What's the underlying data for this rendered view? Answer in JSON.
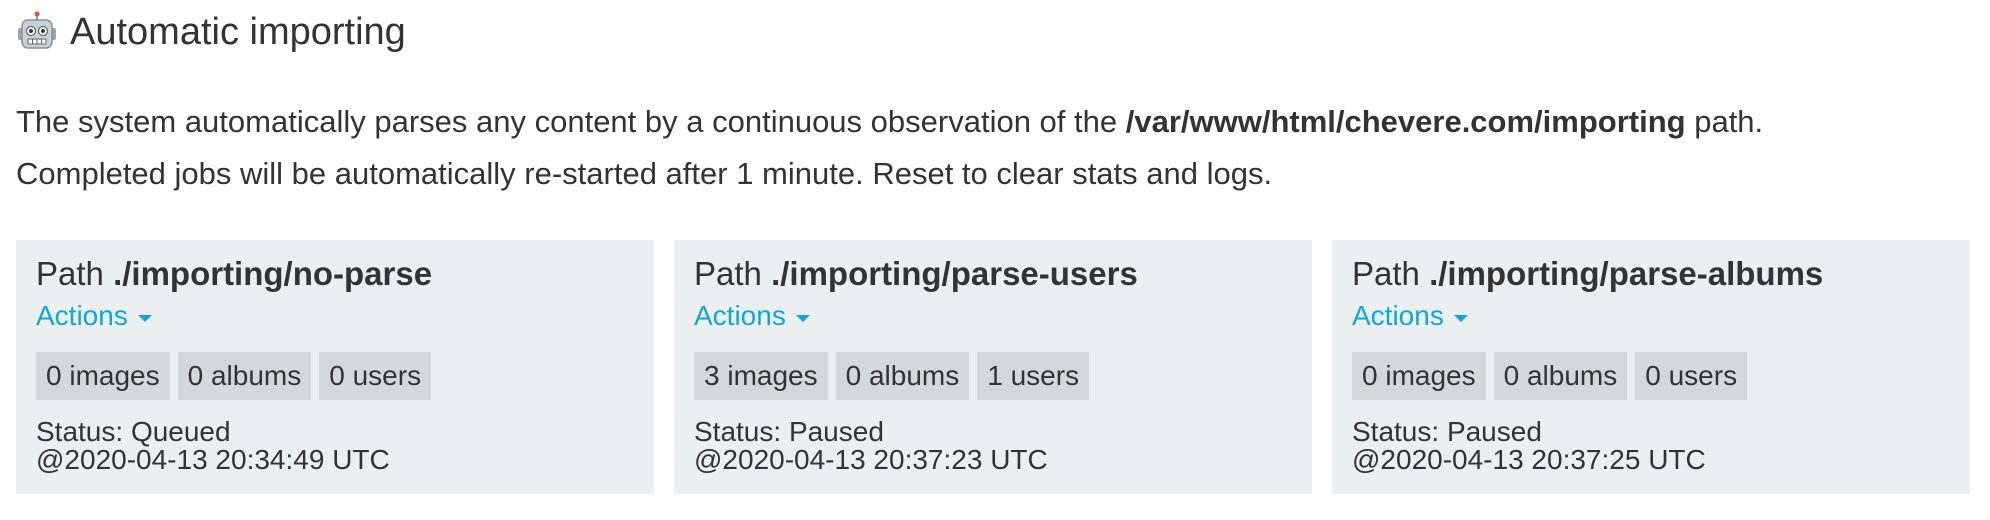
{
  "header": {
    "icon": "robot-icon",
    "title": "Automatic importing"
  },
  "description": {
    "line1_prefix": "The system automatically parses any content by a continuous observation of the ",
    "line1_path": "/var/www/html/chevere.com/importing",
    "line1_suffix": " path.",
    "line2": "Completed jobs will be automatically re-started after 1 minute. Reset to clear stats and logs."
  },
  "cards": [
    {
      "path_prefix": "Path ",
      "path": "./importing/no-parse",
      "actions_label": "Actions",
      "images": "0 images",
      "albums": "0 albums",
      "users": "0 users",
      "status": "Status: Queued",
      "timestamp": "@2020-04-13 20:34:49 UTC"
    },
    {
      "path_prefix": "Path ",
      "path": "./importing/parse-users",
      "actions_label": "Actions",
      "images": "3 images",
      "albums": "0 albums",
      "users": "1 users",
      "status": "Status: Paused",
      "timestamp": "@2020-04-13 20:37:23 UTC"
    },
    {
      "path_prefix": "Path ",
      "path": "./importing/parse-albums",
      "actions_label": "Actions",
      "images": "0 images",
      "albums": "0 albums",
      "users": "0 users",
      "status": "Status: Paused",
      "timestamp": "@2020-04-13 20:37:25 UTC"
    }
  ],
  "colors": {
    "link": "#0da6dd",
    "card_bg": "#eceff0",
    "badge_bg": "#d5d8d9",
    "text": "#333333"
  }
}
